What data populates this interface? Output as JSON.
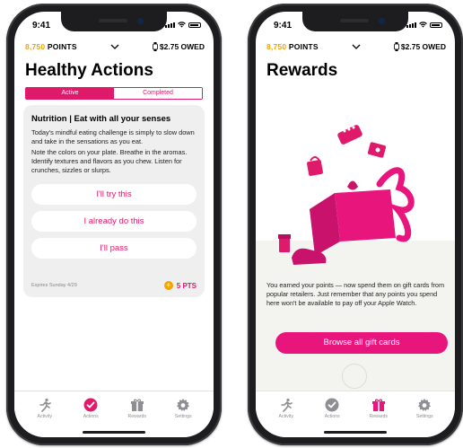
{
  "status": {
    "time": "9:41"
  },
  "colors": {
    "accent": "#e01a6a",
    "points": "#f5a300",
    "tab_active_left": "#e01a6a",
    "tab_active_right": "#e8157d"
  },
  "left": {
    "points_label": "8,750",
    "points_suffix": " POINTS",
    "owed_label": "$2.75 OWED",
    "title": "Healthy Actions",
    "segments": {
      "active": "Active",
      "completed": "Completed"
    },
    "card": {
      "title": "Nutrition | Eat with all your senses",
      "p1": "Today's mindful eating challenge is simply to slow down and take in the sensations as you eat.",
      "p2": "Note the colors on your plate. Breathe in the aromas. Identify textures and flavors as you chew. Listen for crunches, sizzles or slurps.",
      "options": [
        "I'll try this",
        "I already do this",
        "I'll pass"
      ],
      "expires": "Expires Sunday 4/29",
      "pts": "5 PTS"
    }
  },
  "right": {
    "points_label": "8,750",
    "points_suffix": " POINTS",
    "owed_label": "$2.75 OWED",
    "title": "Rewards",
    "body": "You earned your points — now spend them on gift cards from popular retailers. Just remember that any points you spend here won't be available to pay off your Apple Watch.",
    "browse_label": "Browse all gift cards"
  },
  "tabs": [
    "Activity",
    "Actions",
    "Rewards",
    "Settings"
  ],
  "tab_icons": [
    "runner-icon",
    "check-circle-icon",
    "gift-icon",
    "gear-icon"
  ]
}
